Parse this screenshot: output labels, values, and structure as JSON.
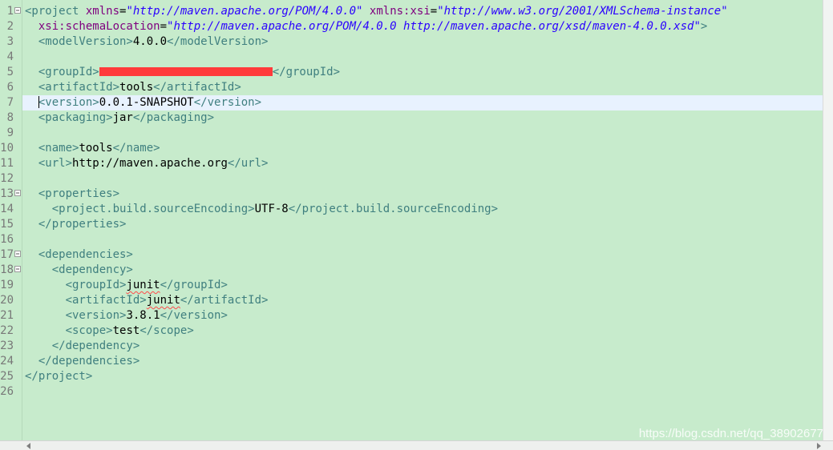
{
  "editor": {
    "current_line": 7,
    "folded_lines": [
      1,
      13,
      17,
      18
    ],
    "line_numbers": [
      "1",
      "2",
      "3",
      "4",
      "5",
      "6",
      "7",
      "8",
      "9",
      "10",
      "11",
      "12",
      "13",
      "14",
      "15",
      "16",
      "17",
      "18",
      "19",
      "20",
      "21",
      "22",
      "23",
      "24",
      "25",
      "26"
    ],
    "lines": [
      [
        {
          "t": "tag",
          "v": "<project "
        },
        {
          "t": "attr",
          "v": "xmlns"
        },
        {
          "t": "txt",
          "v": "="
        },
        {
          "t": "val",
          "v": "\"http://maven.apache.org/POM/4.0.0\""
        },
        {
          "t": "txt",
          "v": " "
        },
        {
          "t": "attr",
          "v": "xmlns:xsi"
        },
        {
          "t": "txt",
          "v": "="
        },
        {
          "t": "val",
          "v": "\"http://www.w3.org/2001/XMLSchema-instance\""
        }
      ],
      [
        {
          "t": "txt",
          "v": "  "
        },
        {
          "t": "attr",
          "v": "xsi:schemaLocation"
        },
        {
          "t": "txt",
          "v": "="
        },
        {
          "t": "val",
          "v": "\"http://maven.apache.org/POM/4.0.0 http://maven.apache.org/xsd/maven-4.0.0.xsd\""
        },
        {
          "t": "tag",
          "v": ">"
        }
      ],
      [
        {
          "t": "txt",
          "v": "  "
        },
        {
          "t": "tag",
          "v": "<modelVersion>"
        },
        {
          "t": "txt",
          "v": "4.0.0"
        },
        {
          "t": "tag",
          "v": "</modelVersion>"
        }
      ],
      [],
      [
        {
          "t": "txt",
          "v": "  "
        },
        {
          "t": "tag",
          "v": "<groupId>"
        },
        {
          "t": "redact",
          "v": ""
        },
        {
          "t": "tag",
          "v": "</groupId>"
        }
      ],
      [
        {
          "t": "txt",
          "v": "  "
        },
        {
          "t": "tag",
          "v": "<artifactId>"
        },
        {
          "t": "txt",
          "v": "tools"
        },
        {
          "t": "tag",
          "v": "</artifactId>"
        }
      ],
      [
        {
          "t": "txt",
          "v": "  "
        },
        {
          "t": "caret",
          "v": ""
        },
        {
          "t": "tag",
          "v": "<version>"
        },
        {
          "t": "txt",
          "v": "0.0.1-SNAPSHOT"
        },
        {
          "t": "tag",
          "v": "</version>"
        }
      ],
      [
        {
          "t": "txt",
          "v": "  "
        },
        {
          "t": "tag",
          "v": "<packaging>"
        },
        {
          "t": "txt",
          "v": "jar"
        },
        {
          "t": "tag",
          "v": "</packaging>"
        }
      ],
      [],
      [
        {
          "t": "txt",
          "v": "  "
        },
        {
          "t": "tag",
          "v": "<name>"
        },
        {
          "t": "txt",
          "v": "tools"
        },
        {
          "t": "tag",
          "v": "</name>"
        }
      ],
      [
        {
          "t": "txt",
          "v": "  "
        },
        {
          "t": "tag",
          "v": "<url>"
        },
        {
          "t": "txt",
          "v": "http://maven.apache.org"
        },
        {
          "t": "tag",
          "v": "</url>"
        }
      ],
      [],
      [
        {
          "t": "txt",
          "v": "  "
        },
        {
          "t": "tag",
          "v": "<properties>"
        }
      ],
      [
        {
          "t": "txt",
          "v": "    "
        },
        {
          "t": "tag",
          "v": "<project.build.sourceEncoding>"
        },
        {
          "t": "txt",
          "v": "UTF-8"
        },
        {
          "t": "tag",
          "v": "</project.build.sourceEncoding>"
        }
      ],
      [
        {
          "t": "txt",
          "v": "  "
        },
        {
          "t": "tag",
          "v": "</properties>"
        }
      ],
      [],
      [
        {
          "t": "txt",
          "v": "  "
        },
        {
          "t": "tag",
          "v": "<dependencies>"
        }
      ],
      [
        {
          "t": "txt",
          "v": "    "
        },
        {
          "t": "tag",
          "v": "<dependency>"
        }
      ],
      [
        {
          "t": "txt",
          "v": "      "
        },
        {
          "t": "tag",
          "v": "<groupId>"
        },
        {
          "t": "squiggle",
          "v": "junit"
        },
        {
          "t": "tag",
          "v": "</groupId>"
        }
      ],
      [
        {
          "t": "txt",
          "v": "      "
        },
        {
          "t": "tag",
          "v": "<artifactId>"
        },
        {
          "t": "squiggle",
          "v": "junit"
        },
        {
          "t": "tag",
          "v": "</artifactId>"
        }
      ],
      [
        {
          "t": "txt",
          "v": "      "
        },
        {
          "t": "tag",
          "v": "<version>"
        },
        {
          "t": "txt",
          "v": "3.8.1"
        },
        {
          "t": "tag",
          "v": "</version>"
        }
      ],
      [
        {
          "t": "txt",
          "v": "      "
        },
        {
          "t": "tag",
          "v": "<scope>"
        },
        {
          "t": "txt",
          "v": "test"
        },
        {
          "t": "tag",
          "v": "</scope>"
        }
      ],
      [
        {
          "t": "txt",
          "v": "    "
        },
        {
          "t": "tag",
          "v": "</dependency>"
        }
      ],
      [
        {
          "t": "txt",
          "v": "  "
        },
        {
          "t": "tag",
          "v": "</dependencies>"
        }
      ],
      [
        {
          "t": "tag",
          "v": "</project>"
        }
      ],
      []
    ]
  },
  "fold_icon": "collapse-minus-icon",
  "scrollbar": {
    "left_icon": "scroll-left-arrow-icon",
    "right_icon": "scroll-right-arrow-icon"
  },
  "watermark": "https://blog.csdn.net/qq_38902677",
  "colors": {
    "background": "#c7ebcc",
    "current_line": "#e8f2fe",
    "tag": "#3f7f7f",
    "attribute": "#7f007f",
    "value": "#2a00ff",
    "redaction": "#ff3b3b"
  }
}
